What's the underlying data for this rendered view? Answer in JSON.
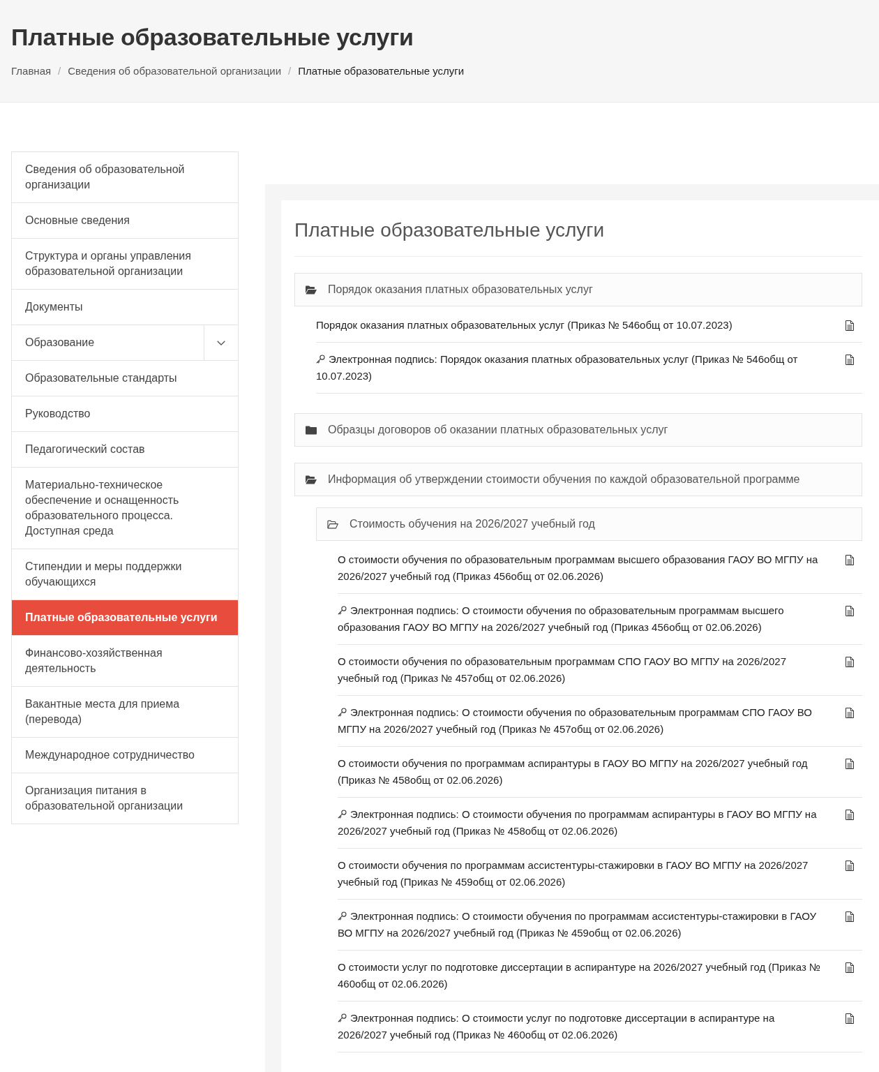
{
  "header": {
    "title": "Платные образовательные услуги",
    "breadcrumb": [
      {
        "label": "Главная",
        "current": false
      },
      {
        "separator": "/",
        "label": "Сведения об образовательной организации",
        "current": false
      },
      {
        "separator": "/",
        "label": "Платные образовательные услуги",
        "current": true
      }
    ]
  },
  "sidebar": {
    "items": [
      {
        "label": "Сведения об образовательной организации",
        "selected": false,
        "expandable": false
      },
      {
        "label": "Основные сведения",
        "selected": false,
        "expandable": false
      },
      {
        "label": "Структура и органы управления образовательной организации",
        "selected": false,
        "expandable": false
      },
      {
        "label": "Документы",
        "selected": false,
        "expandable": false
      },
      {
        "label": "Образование",
        "selected": false,
        "expandable": true
      },
      {
        "label": "Образовательные стандарты",
        "selected": false,
        "expandable": false
      },
      {
        "label": "Руководство",
        "selected": false,
        "expandable": false
      },
      {
        "label": "Педагогический состав",
        "selected": false,
        "expandable": false
      },
      {
        "label": "Материально-техническое обеспечение и оснащенность образовательного процесса. Доступная среда",
        "selected": false,
        "expandable": false
      },
      {
        "label": "Стипендии и меры поддержки обучающихся",
        "selected": false,
        "expandable": false
      },
      {
        "label": "Платные образовательные услуги",
        "selected": true,
        "expandable": false
      },
      {
        "label": "Финансово-хозяйственная деятельность",
        "selected": false,
        "expandable": false
      },
      {
        "label": "Вакантные места для приема (перевода)",
        "selected": false,
        "expandable": false
      },
      {
        "label": "Международное сотрудничество",
        "selected": false,
        "expandable": false
      },
      {
        "label": "Организация питания в образовательной организации",
        "selected": false,
        "expandable": false
      }
    ]
  },
  "content": {
    "title": "Платные образовательные услуги",
    "folders": [
      {
        "title": "Порядок оказания платных образовательных услуг",
        "expanded": true,
        "documents": [
          {
            "kind": "document",
            "title": "Порядок оказания платных образовательных услуг (Приказ № 546общ от 10.07.2023)"
          },
          {
            "kind": "signature",
            "title": "Электронная подпись: Порядок оказания платных образовательных услуг (Приказ № 546общ от 10.07.2023)"
          }
        ]
      },
      {
        "title": "Образцы договоров об оказании платных образовательных услуг",
        "expanded": false
      },
      {
        "title": "Информация об утверждении стоимости обучения по каждой образовательной программе",
        "expanded": true,
        "children": [
          {
            "title": "Стоимость обучения на 2026/2027 учебный год",
            "expanded": true,
            "documents": [
              {
                "kind": "document",
                "title": "О стоимости обучения по образовательным программам высшего образования ГАОУ ВО МГПУ на 2026/2027 учебный год (Приказ 456общ от 02.06.2026)"
              },
              {
                "kind": "signature",
                "title": "Электронная подпись: О стоимости обучения по образовательным программам высшего образования ГАОУ ВО МГПУ на 2026/2027 учебный год (Приказ 456общ от 02.06.2026)"
              },
              {
                "kind": "document",
                "title": "О стоимости обучения по образовательным программам СПО ГАОУ ВО МГПУ на 2026/2027 учебный год (Приказ № 457общ от 02.06.2026)"
              },
              {
                "kind": "signature",
                "title": "Электронная подпись: О стоимости обучения по образовательным программам СПО ГАОУ ВО МГПУ на 2026/2027 учебный год (Приказ № 457общ от 02.06.2026)"
              },
              {
                "kind": "document",
                "title": "О стоимости обучения по программам аспирантуры в ГАОУ ВО МГПУ на 2026/2027 учебный год (Приказ № 458общ от 02.06.2026)"
              },
              {
                "kind": "signature",
                "title": "Электронная подпись: О стоимости обучения по программам аспирантуры в ГАОУ ВО МГПУ на 2026/2027 учебный год (Приказ № 458общ от 02.06.2026)"
              },
              {
                "kind": "document",
                "title": "О стоимости обучения по программам ассистентуры-стажировки в ГАОУ ВО МГПУ на 2026/2027 учебный год (Приказ № 459общ от 02.06.2026)"
              },
              {
                "kind": "signature",
                "title": "Электронная подпись: О стоимости обучения по программам ассистентуры-стажировки в ГАОУ ВО МГПУ на 2026/2027 учебный год (Приказ № 459общ от 02.06.2026)"
              },
              {
                "kind": "document",
                "title": "О стоимости услуг по подготовке диссертации в аспирантуре на 2026/2027 учебный год (Приказ № 460общ от 02.06.2026)"
              },
              {
                "kind": "signature",
                "title": "Электронная подпись: О стоимости услуг по подготовке диссертации в аспирантуре на 2026/2027 учебный год (Приказ № 460общ от 02.06.2026)"
              }
            ]
          }
        ]
      }
    ]
  }
}
